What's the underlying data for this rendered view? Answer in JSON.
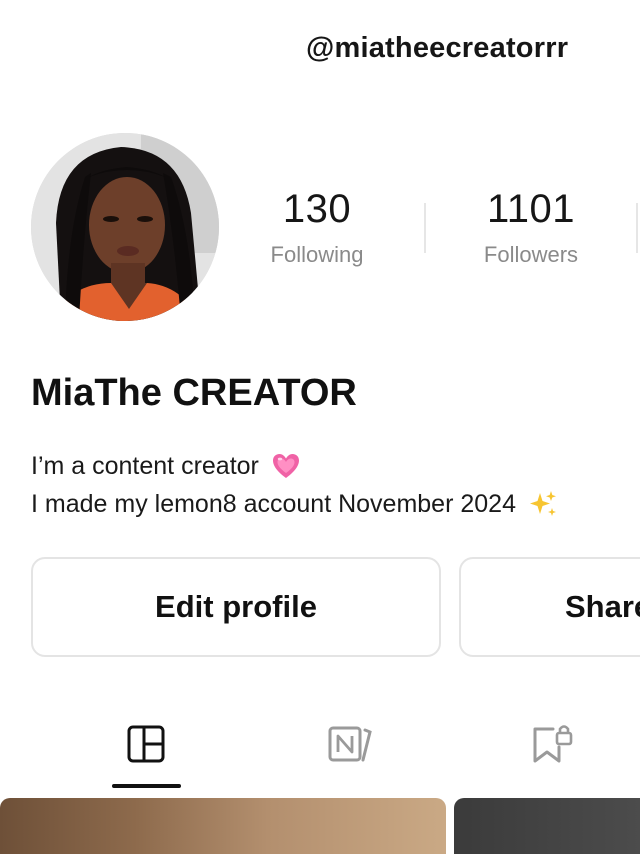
{
  "profile": {
    "username": "@miatheecreatorrr",
    "display_name": "MiaThe CREATOR",
    "bio": {
      "line1": "I’m a content creator",
      "line1_emoji": "pink-heart-emoji",
      "line2": "I made my lemon8 account November 2024",
      "line2_emoji": "sparkles-emoji"
    }
  },
  "stats": {
    "following": {
      "count": "130",
      "label": "Following"
    },
    "followers": {
      "count": "1101",
      "label": "Followers"
    }
  },
  "actions": {
    "edit_label": "Edit profile",
    "share_label": "Share"
  },
  "tabs": [
    {
      "icon": "grid-layout-icon",
      "active": true
    },
    {
      "icon": "notes-icon",
      "active": false
    },
    {
      "icon": "bookmark-lock-icon",
      "active": false
    }
  ],
  "colors": {
    "text": "#111111",
    "muted": "#8a8a8a",
    "border": "#e4e4e4",
    "active_underline": "#111111"
  }
}
